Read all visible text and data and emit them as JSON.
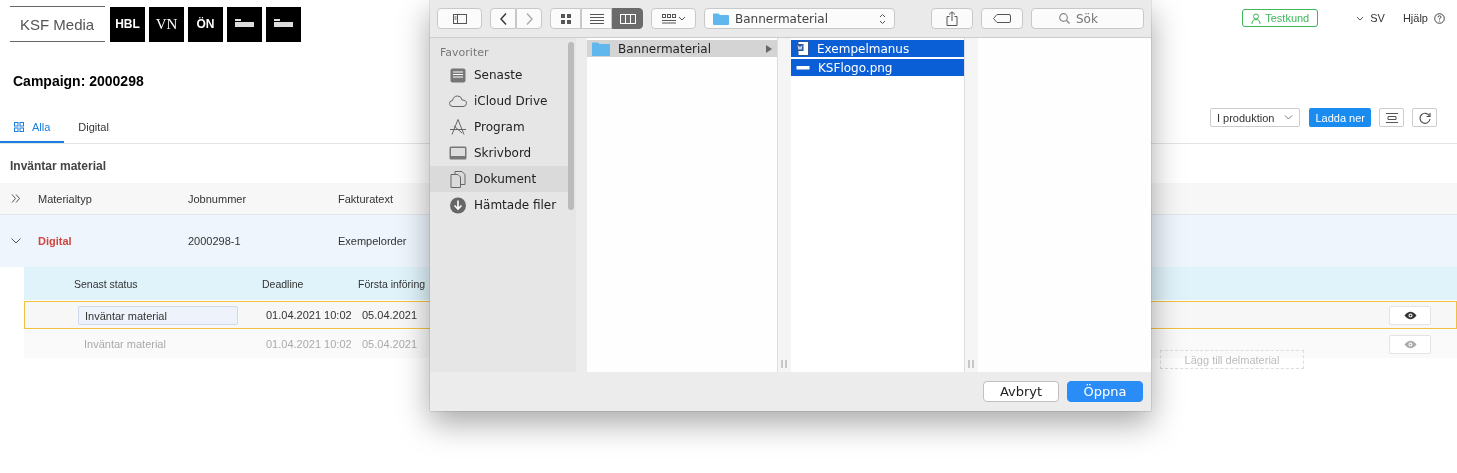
{
  "header": {
    "brand": "KSF Media",
    "logos": [
      {
        "kind": "bold",
        "text": "HBL"
      },
      {
        "kind": "serif",
        "text": "VN"
      },
      {
        "kind": "bold",
        "text": "ÖN"
      },
      {
        "kind": "mark"
      },
      {
        "kind": "mark"
      }
    ],
    "user": "Testkund",
    "language": "SV",
    "help": "Hjälp"
  },
  "campaign_title": "Campaign: 2000298",
  "tabs": [
    {
      "label": "Alla",
      "kind": "grid",
      "selected": true
    },
    {
      "label": "Digital",
      "kind": "plain",
      "selected": false
    }
  ],
  "toolbar": {
    "status_filter": "I produktion",
    "download": "Ladda ner"
  },
  "section_title": "Inväntar material",
  "table": {
    "columns": [
      "Materialtyp",
      "Jobnummer",
      "Fakturatext"
    ],
    "rows": [
      {
        "expanded": true,
        "material_type": "Digital",
        "job_number": "2000298-1",
        "invoice_text": "Exempelorder"
      }
    ]
  },
  "subtable": {
    "columns": [
      "Senast status",
      "Deadline",
      "Första införing"
    ],
    "rows": [
      {
        "selected": true,
        "status": "Inväntar material",
        "deadline": "01.04.2021 10:02",
        "first_insertion": "05.04.2021"
      },
      {
        "selected": false,
        "status": "Inväntar material",
        "deadline": "01.04.2021 10:02",
        "first_insertion": "05.04.2021"
      }
    ],
    "add_button": "Lägg till delmaterial"
  },
  "dialog": {
    "view_buttons": [
      {
        "kind": "icons",
        "selected": false
      },
      {
        "kind": "list",
        "selected": false
      },
      {
        "kind": "columns",
        "selected": true
      }
    ],
    "location": "Bannermaterial",
    "search_placeholder": "Sök",
    "sidebar_heading": "Favoriter",
    "sidebar": [
      {
        "label": "Senaste",
        "kind": "recents",
        "selected": false
      },
      {
        "label": "iCloud Drive",
        "kind": "cloud",
        "selected": false
      },
      {
        "label": "Program",
        "kind": "apps",
        "selected": false
      },
      {
        "label": "Skrivbord",
        "kind": "desktop",
        "selected": false
      },
      {
        "label": "Dokument",
        "kind": "document",
        "selected": true
      },
      {
        "label": "Hämtade filer",
        "kind": "download",
        "selected": false
      }
    ],
    "columns": [
      {
        "focused": false,
        "items": [
          {
            "name": "Bannermaterial",
            "kind": "folder",
            "selected": true
          }
        ]
      },
      {
        "focused": true,
        "items": [
          {
            "name": "Exempelmanus",
            "kind": "word",
            "selected": true
          },
          {
            "name": "KSFlogo.png",
            "kind": "image",
            "selected": true
          }
        ]
      }
    ],
    "buttons": {
      "cancel": "Avbryt",
      "open": "Öppna"
    }
  }
}
